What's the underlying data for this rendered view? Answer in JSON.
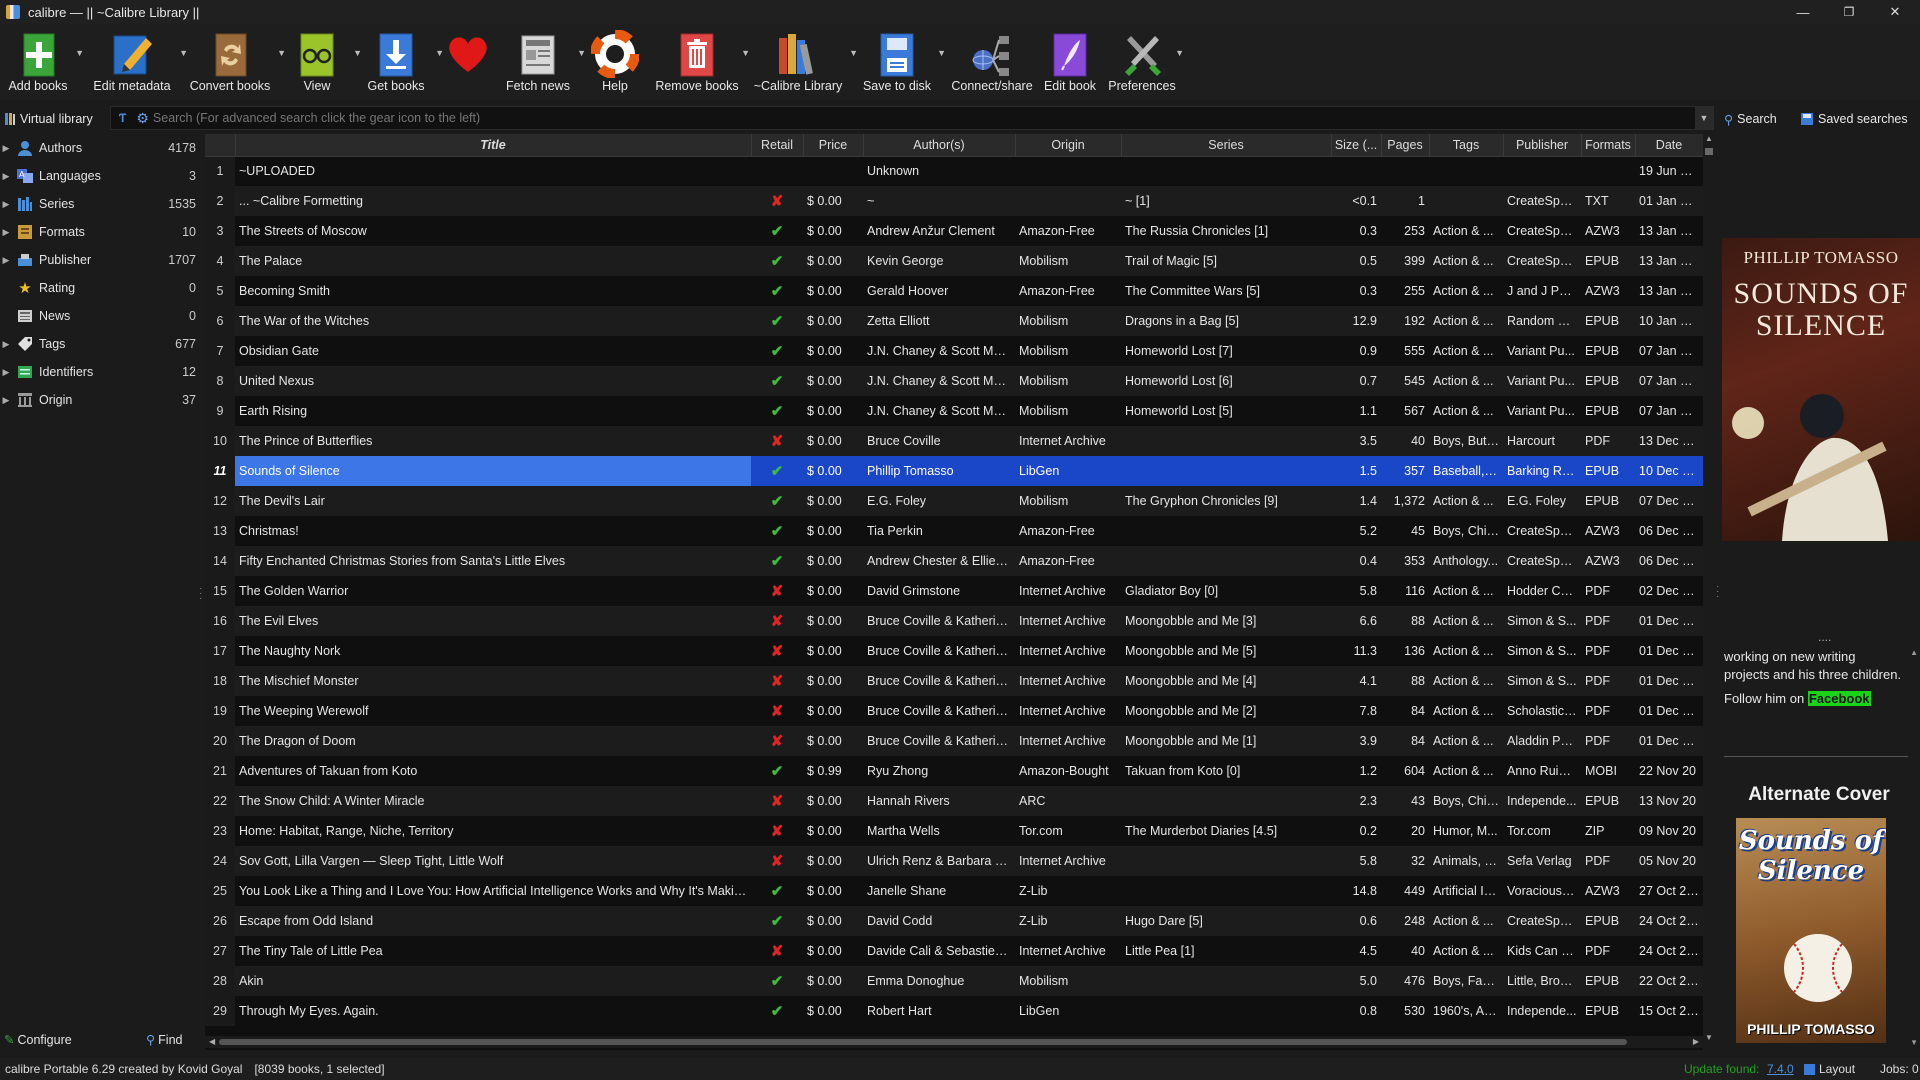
{
  "window": {
    "title": "calibre — || ~Calibre Library ||",
    "minimize": "—",
    "maximize": "❐",
    "close": "✕"
  },
  "toolbar": [
    {
      "label": "Add books",
      "icon": "add-books-icon",
      "drop": true
    },
    {
      "label": "Edit metadata",
      "icon": "edit-metadata-icon",
      "drop": true
    },
    {
      "label": "Convert books",
      "icon": "convert-books-icon",
      "drop": true
    },
    {
      "label": "View",
      "icon": "view-icon",
      "drop": true
    },
    {
      "label": "Get books",
      "icon": "get-books-icon",
      "drop": true
    },
    {
      "label": "",
      "icon": "heart-icon",
      "drop": false
    },
    {
      "label": "Fetch news",
      "icon": "fetch-news-icon",
      "drop": true
    },
    {
      "label": "Help",
      "icon": "help-lifebuoy-icon",
      "drop": false
    },
    {
      "label": "Remove books",
      "icon": "remove-books-icon",
      "drop": true
    },
    {
      "label": "~Calibre Library",
      "icon": "library-icon",
      "drop": true
    },
    {
      "label": "Save to disk",
      "icon": "save-to-disk-icon",
      "drop": true
    },
    {
      "label": "Connect/share",
      "icon": "connect-share-icon",
      "drop": false
    },
    {
      "label": "Edit book",
      "icon": "edit-book-icon",
      "drop": false
    },
    {
      "label": "Preferences",
      "icon": "preferences-icon",
      "drop": true
    }
  ],
  "search": {
    "virtual_library": "Virtual library",
    "placeholder": "Search (For advanced search click the gear icon to the left)",
    "search_button": "Search",
    "saved_searches": "Saved searches"
  },
  "sidebar": {
    "items": [
      {
        "label": "Authors",
        "count": "4178",
        "icon": "authors-icon",
        "color": "#4a8fd8"
      },
      {
        "label": "Languages",
        "count": "3",
        "icon": "languages-icon",
        "color": "#4a70d8"
      },
      {
        "label": "Series",
        "count": "1535",
        "icon": "series-icon",
        "color": "#4a8fd8"
      },
      {
        "label": "Formats",
        "count": "10",
        "icon": "formats-icon",
        "color": "#c89a3a"
      },
      {
        "label": "Publisher",
        "count": "1707",
        "icon": "publisher-icon",
        "color": "#4a8fd8"
      },
      {
        "label": "Rating",
        "count": "0",
        "icon": "star-icon",
        "color": "#f0c020"
      },
      {
        "label": "News",
        "count": "0",
        "icon": "news-icon",
        "color": "#cfcfcf"
      },
      {
        "label": "Tags",
        "count": "677",
        "icon": "tags-icon",
        "color": "#e0e0e0"
      },
      {
        "label": "Identifiers",
        "count": "12",
        "icon": "identifiers-icon",
        "color": "#2fa84f"
      },
      {
        "label": "Origin",
        "count": "37",
        "icon": "origin-icon",
        "color": "#9a9a9a"
      }
    ],
    "configure": "Configure",
    "find": "Find"
  },
  "table": {
    "headers": [
      "Title",
      "Retail",
      "Price",
      "Author(s)",
      "Origin",
      "Series",
      "Size (...",
      "Pages",
      "Tags",
      "Publisher",
      "Formats",
      "Date"
    ],
    "rows": [
      {
        "n": "1",
        "title": "~UPLOADED",
        "retail": "",
        "price": "",
        "author": "Unknown",
        "origin": "",
        "series": "",
        "size": "",
        "pages": "",
        "tags": "",
        "publisher": "",
        "formats": "",
        "date": "19 Jun 202"
      },
      {
        "n": "2",
        "title": "... ~Calibre Formetting",
        "retail": "no",
        "price": "$ 0.00",
        "author": "~",
        "origin": "",
        "series": "~ [1]",
        "size": "<0.1",
        "pages": "1",
        "tags": "",
        "publisher": "CreateSpac...",
        "formats": "TXT",
        "date": "01 Jan 202"
      },
      {
        "n": "3",
        "title": "The Streets of Moscow",
        "retail": "ok",
        "price": "$ 0.00",
        "author": "Andrew Anžur Clement",
        "origin": "Amazon-Free",
        "series": "The Russia Chronicles [1]",
        "size": "0.3",
        "pages": "253",
        "tags": "Action & ...",
        "publisher": "CreateSpac...",
        "formats": "AZW3",
        "date": "13 Jan 202"
      },
      {
        "n": "4",
        "title": "The Palace",
        "retail": "ok",
        "price": "$ 0.00",
        "author": "Kevin George",
        "origin": "Mobilism",
        "series": "Trail of Magic [5]",
        "size": "0.5",
        "pages": "399",
        "tags": "Action & ...",
        "publisher": "CreateSpac...",
        "formats": "EPUB",
        "date": "13 Jan 202"
      },
      {
        "n": "5",
        "title": "Becoming Smith",
        "retail": "ok",
        "price": "$ 0.00",
        "author": "Gerald Hoover",
        "origin": "Amazon-Free",
        "series": "The Committee Wars [5]",
        "size": "0.3",
        "pages": "255",
        "tags": "Action & ...",
        "publisher": "J and J Pub...",
        "formats": "AZW3",
        "date": "13 Jan 202"
      },
      {
        "n": "6",
        "title": "The War of the Witches",
        "retail": "ok",
        "price": "$ 0.00",
        "author": "Zetta Elliott",
        "origin": "Mobilism",
        "series": "Dragons in a Bag [5]",
        "size": "12.9",
        "pages": "192",
        "tags": "Action & ...",
        "publisher": "Random H...",
        "formats": "EPUB",
        "date": "10 Jan 202"
      },
      {
        "n": "7",
        "title": "Obsidian Gate",
        "retail": "ok",
        "price": "$ 0.00",
        "author": "J.N. Chaney & Scott Moon",
        "origin": "Mobilism",
        "series": "Homeworld Lost [7]",
        "size": "0.9",
        "pages": "555",
        "tags": "Action & ...",
        "publisher": "Variant Pu...",
        "formats": "EPUB",
        "date": "07 Jan 202"
      },
      {
        "n": "8",
        "title": "United Nexus",
        "retail": "ok",
        "price": "$ 0.00",
        "author": "J.N. Chaney & Scott Moon",
        "origin": "Mobilism",
        "series": "Homeworld Lost [6]",
        "size": "0.7",
        "pages": "545",
        "tags": "Action & ...",
        "publisher": "Variant Pu...",
        "formats": "EPUB",
        "date": "07 Jan 202"
      },
      {
        "n": "9",
        "title": "Earth Rising",
        "retail": "ok",
        "price": "$ 0.00",
        "author": "J.N. Chaney & Scott Moon",
        "origin": "Mobilism",
        "series": "Homeworld Lost [5]",
        "size": "1.1",
        "pages": "567",
        "tags": "Action & ...",
        "publisher": "Variant Pu...",
        "formats": "EPUB",
        "date": "07 Jan 202"
      },
      {
        "n": "10",
        "title": "The Prince of Butterflies",
        "retail": "no",
        "price": "$ 0.00",
        "author": "Bruce Coville",
        "origin": "Internet Archive",
        "series": "",
        "size": "3.5",
        "pages": "40",
        "tags": "Boys, Butt...",
        "publisher": "Harcourt",
        "formats": "PDF",
        "date": "13 Dec 202"
      },
      {
        "n": "11",
        "title": "Sounds of Silence",
        "retail": "ok",
        "price": "$ 0.00",
        "author": "Phillip Tomasso",
        "origin": "LibGen",
        "series": "",
        "size": "1.5",
        "pages": "357",
        "tags": "Baseball, B...",
        "publisher": "Barking Rai...",
        "formats": "EPUB",
        "date": "10 Dec 202",
        "selected": true
      },
      {
        "n": "12",
        "title": "The Devil's Lair",
        "retail": "ok",
        "price": "$ 0.00",
        "author": "E.G. Foley",
        "origin": "Mobilism",
        "series": "The Gryphon Chronicles [9]",
        "size": "1.4",
        "pages": "1,372",
        "tags": "Action & ...",
        "publisher": "E.G. Foley",
        "formats": "EPUB",
        "date": "07 Dec 202"
      },
      {
        "n": "13",
        "title": "Christmas!",
        "retail": "ok",
        "price": "$ 0.00",
        "author": "Tia Perkin",
        "origin": "Amazon-Free",
        "series": "",
        "size": "5.2",
        "pages": "45",
        "tags": "Boys, Chil...",
        "publisher": "CreateSpac...",
        "formats": "AZW3",
        "date": "06 Dec 202"
      },
      {
        "n": "14",
        "title": "Fifty Enchanted Christmas Stories from Santa's Little Elves",
        "retail": "ok",
        "price": "$ 0.00",
        "author": "Andrew Chester & Ellie C...",
        "origin": "Amazon-Free",
        "series": "",
        "size": "0.4",
        "pages": "353",
        "tags": "Anthology...",
        "publisher": "CreateSpac...",
        "formats": "AZW3",
        "date": "06 Dec 202"
      },
      {
        "n": "15",
        "title": "The Golden Warrior",
        "retail": "no",
        "price": "$ 0.00",
        "author": "David Grimstone",
        "origin": "Internet Archive",
        "series": "Gladiator Boy [0]",
        "size": "5.8",
        "pages": "116",
        "tags": "Action & ...",
        "publisher": "Hodder Ch...",
        "formats": "PDF",
        "date": "02 Dec 202"
      },
      {
        "n": "16",
        "title": "The Evil Elves",
        "retail": "no",
        "price": "$ 0.00",
        "author": "Bruce Coville & Katherine...",
        "origin": "Internet Archive",
        "series": "Moongobble and Me [3]",
        "size": "6.6",
        "pages": "88",
        "tags": "Action & ...",
        "publisher": "Simon & S...",
        "formats": "PDF",
        "date": "01 Dec 202"
      },
      {
        "n": "17",
        "title": "The Naughty Nork",
        "retail": "no",
        "price": "$ 0.00",
        "author": "Bruce Coville & Katherine...",
        "origin": "Internet Archive",
        "series": "Moongobble and Me [5]",
        "size": "11.3",
        "pages": "136",
        "tags": "Action & ...",
        "publisher": "Simon & S...",
        "formats": "PDF",
        "date": "01 Dec 202"
      },
      {
        "n": "18",
        "title": "The Mischief Monster",
        "retail": "no",
        "price": "$ 0.00",
        "author": "Bruce Coville & Katherine...",
        "origin": "Internet Archive",
        "series": "Moongobble and Me [4]",
        "size": "4.1",
        "pages": "88",
        "tags": "Action & ...",
        "publisher": "Simon & S...",
        "formats": "PDF",
        "date": "01 Dec 202"
      },
      {
        "n": "19",
        "title": "The Weeping Werewolf",
        "retail": "no",
        "price": "$ 0.00",
        "author": "Bruce Coville & Katherine...",
        "origin": "Internet Archive",
        "series": "Moongobble and Me [2]",
        "size": "7.8",
        "pages": "84",
        "tags": "Action & ...",
        "publisher": "Scholastic I...",
        "formats": "PDF",
        "date": "01 Dec 202"
      },
      {
        "n": "20",
        "title": "The Dragon of Doom",
        "retail": "no",
        "price": "$ 0.00",
        "author": "Bruce Coville & Katherine...",
        "origin": "Internet Archive",
        "series": "Moongobble and Me [1]",
        "size": "3.9",
        "pages": "84",
        "tags": "Action & ...",
        "publisher": "Aladdin Pa...",
        "formats": "PDF",
        "date": "01 Dec 202"
      },
      {
        "n": "21",
        "title": "Adventures of Takuan from Koto",
        "retail": "ok",
        "price": "$ 0.99",
        "author": "Ryu Zhong",
        "origin": "Amazon-Bought",
        "series": "Takuan from Koto [0]",
        "size": "1.2",
        "pages": "604",
        "tags": "Action & ...",
        "publisher": "Anno Ruini...",
        "formats": "MOBI",
        "date": "22 Nov 20"
      },
      {
        "n": "22",
        "title": "The Snow Child: A Winter Miracle",
        "retail": "no",
        "price": "$ 0.00",
        "author": "Hannah Rivers",
        "origin": "ARC",
        "series": "",
        "size": "2.3",
        "pages": "43",
        "tags": "Boys, Chil...",
        "publisher": "Independe...",
        "formats": "EPUB",
        "date": "13 Nov 20"
      },
      {
        "n": "23",
        "title": "Home: Habitat, Range, Niche, Territory",
        "retail": "no",
        "price": "$ 0.00",
        "author": "Martha Wells",
        "origin": "Tor.com",
        "series": "The Murderbot Diaries [4.5]",
        "size": "0.2",
        "pages": "20",
        "tags": "Humor, M...",
        "publisher": "Tor.com",
        "formats": "ZIP",
        "date": "09 Nov 20"
      },
      {
        "n": "24",
        "title": "Sov Gott, Lilla Vargen — Sleep Tight, Little Wolf",
        "retail": "no",
        "price": "$ 0.00",
        "author": "Ulrich Renz & Barbara Bri...",
        "origin": "Internet Archive",
        "series": "",
        "size": "5.8",
        "pages": "32",
        "tags": "Animals, B...",
        "publisher": "Sefa Verlag",
        "formats": "PDF",
        "date": "05 Nov 20"
      },
      {
        "n": "25",
        "title": "You Look Like a Thing and I Love You: How Artificial Intelligence Works and Why It's Making th...",
        "retail": "ok",
        "price": "$ 0.00",
        "author": "Janelle Shane",
        "origin": "Z-Lib",
        "series": "",
        "size": "14.8",
        "pages": "449",
        "tags": "Artificial In...",
        "publisher": "Voracious (...",
        "formats": "AZW3",
        "date": "27 Oct 202"
      },
      {
        "n": "26",
        "title": "Escape from Odd Island",
        "retail": "ok",
        "price": "$ 0.00",
        "author": "David Codd",
        "origin": "Z-Lib",
        "series": "Hugo Dare [5]",
        "size": "0.6",
        "pages": "248",
        "tags": "Action & ...",
        "publisher": "CreateSpac...",
        "formats": "EPUB",
        "date": "24 Oct 202"
      },
      {
        "n": "27",
        "title": "The Tiny Tale of Little Pea",
        "retail": "no",
        "price": "$ 0.00",
        "author": "Davide Cali & Sebastien ...",
        "origin": "Internet Archive",
        "series": "Little Pea [1]",
        "size": "4.5",
        "pages": "40",
        "tags": "Action & ...",
        "publisher": "Kids Can P...",
        "formats": "PDF",
        "date": "24 Oct 202"
      },
      {
        "n": "28",
        "title": "Akin",
        "retail": "ok",
        "price": "$ 0.00",
        "author": "Emma Donoghue",
        "origin": "Mobilism",
        "series": "",
        "size": "5.0",
        "pages": "476",
        "tags": "Boys, Fami...",
        "publisher": "Little, Brow...",
        "formats": "EPUB",
        "date": "22 Oct 202"
      },
      {
        "n": "29",
        "title": "Through My Eyes. Again.",
        "retail": "ok",
        "price": "$ 0.00",
        "author": "Robert Hart",
        "origin": "LibGen",
        "series": "",
        "size": "0.8",
        "pages": "530",
        "tags": "1960's, Ab...",
        "publisher": "Independe...",
        "formats": "EPUB",
        "date": "15 Oct 202"
      }
    ]
  },
  "details": {
    "cover_author": "PHILLIP TOMASSO",
    "cover_title": "SOUNDS OF SILENCE",
    "ellipsis": "....",
    "description": "working on new writing projects and his three children.",
    "follow_prefix": "Follow him on ",
    "follow_link": "Facebook",
    "alt_cover_heading": "Alternate Cover",
    "alt_cover_title": "Sounds of Silence",
    "alt_cover_author": "PHILLIP TOMASSO"
  },
  "status": {
    "left": "calibre Portable 6.29 created by Kovid Goyal",
    "books": "[8039 books, 1 selected]",
    "update_prefix": "Update found:",
    "update_version": "7.4.0",
    "layout": "Layout",
    "jobs": "Jobs: 0"
  },
  "colors": {
    "selection": "#1a47c8",
    "retail_ok": "#3fb93f",
    "retail_no": "#e02323",
    "facebook_highlight": "#19d419",
    "update_text": "#1fa31f"
  }
}
